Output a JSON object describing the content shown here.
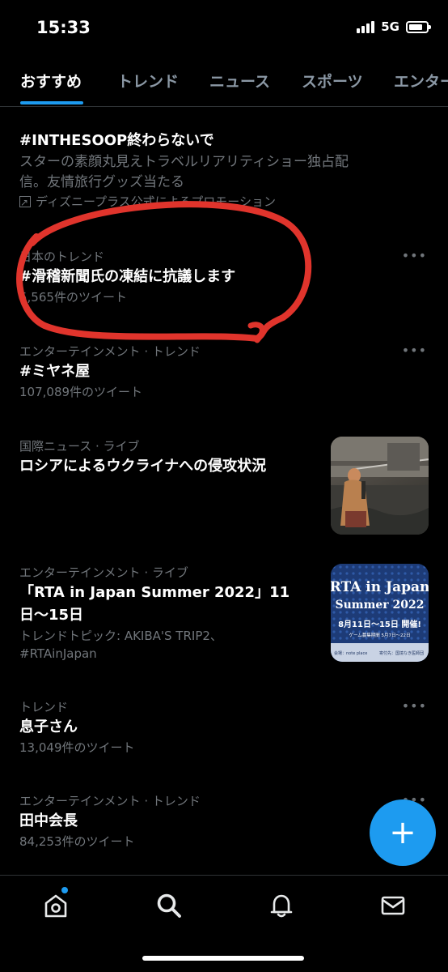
{
  "status": {
    "time": "15:33",
    "network": "5G",
    "battery_fill": 0.8
  },
  "tabs": [
    {
      "label": "おすすめ",
      "active": true
    },
    {
      "label": "トレンド",
      "active": false
    },
    {
      "label": "ニュース",
      "active": false
    },
    {
      "label": "スポーツ",
      "active": false
    },
    {
      "label": "エンター",
      "active": false
    }
  ],
  "promoted": {
    "title": "#INTHESOOP終わらないで",
    "description_line1": "スターの素顔丸見えトラベルリアリティショー独占配",
    "description_line2": "信。友情旅行グッズ当たる",
    "promoted_by": "ディズニープラス公式によるプロモーション"
  },
  "trends": [
    {
      "context": "日本のトレンド",
      "title": "#滑稽新聞氏の凍結に抗議します",
      "count": "5,565件のツイート"
    },
    {
      "context": "エンターテインメント · トレンド",
      "title": "#ミヤネ屋",
      "count": "107,089件のツイート"
    }
  ],
  "news": [
    {
      "context": "国際ニュース · ライブ",
      "title": "ロシアによるウクライナへの侵攻状況",
      "thumb_icon": "ukraine-photo"
    },
    {
      "context": "エンターテインメント · ライブ",
      "title_line1": "「RTA in Japan Summer 2022」11",
      "title_line2": "日〜15日",
      "topics_line1": "トレンドトピック: AKIBA'S TRIP2、",
      "topics_line2": "#RTAinJapan",
      "thumb": {
        "line1": "RTA in Japan",
        "line2": "Summer 2022",
        "line3": "8月11日〜15日 開催!",
        "line4": "ゲーム募集期間 5月7日〜22日",
        "footer_left": "会場：note place",
        "footer_right": "寄付先：国境なき医師団"
      }
    }
  ],
  "trends_more": [
    {
      "context": "トレンド",
      "title": "息子さん",
      "count": "13,049件のツイート"
    },
    {
      "context": "エンターテインメント · トレンド",
      "title": "田中会長",
      "count": "84,253件のツイート"
    }
  ],
  "more_label": "•••",
  "fab_label": "+",
  "nav": [
    "home-icon",
    "search-icon",
    "bell-icon",
    "mail-icon"
  ],
  "colors": {
    "accent": "#1d9bf0",
    "annotation": "#e0342c"
  }
}
